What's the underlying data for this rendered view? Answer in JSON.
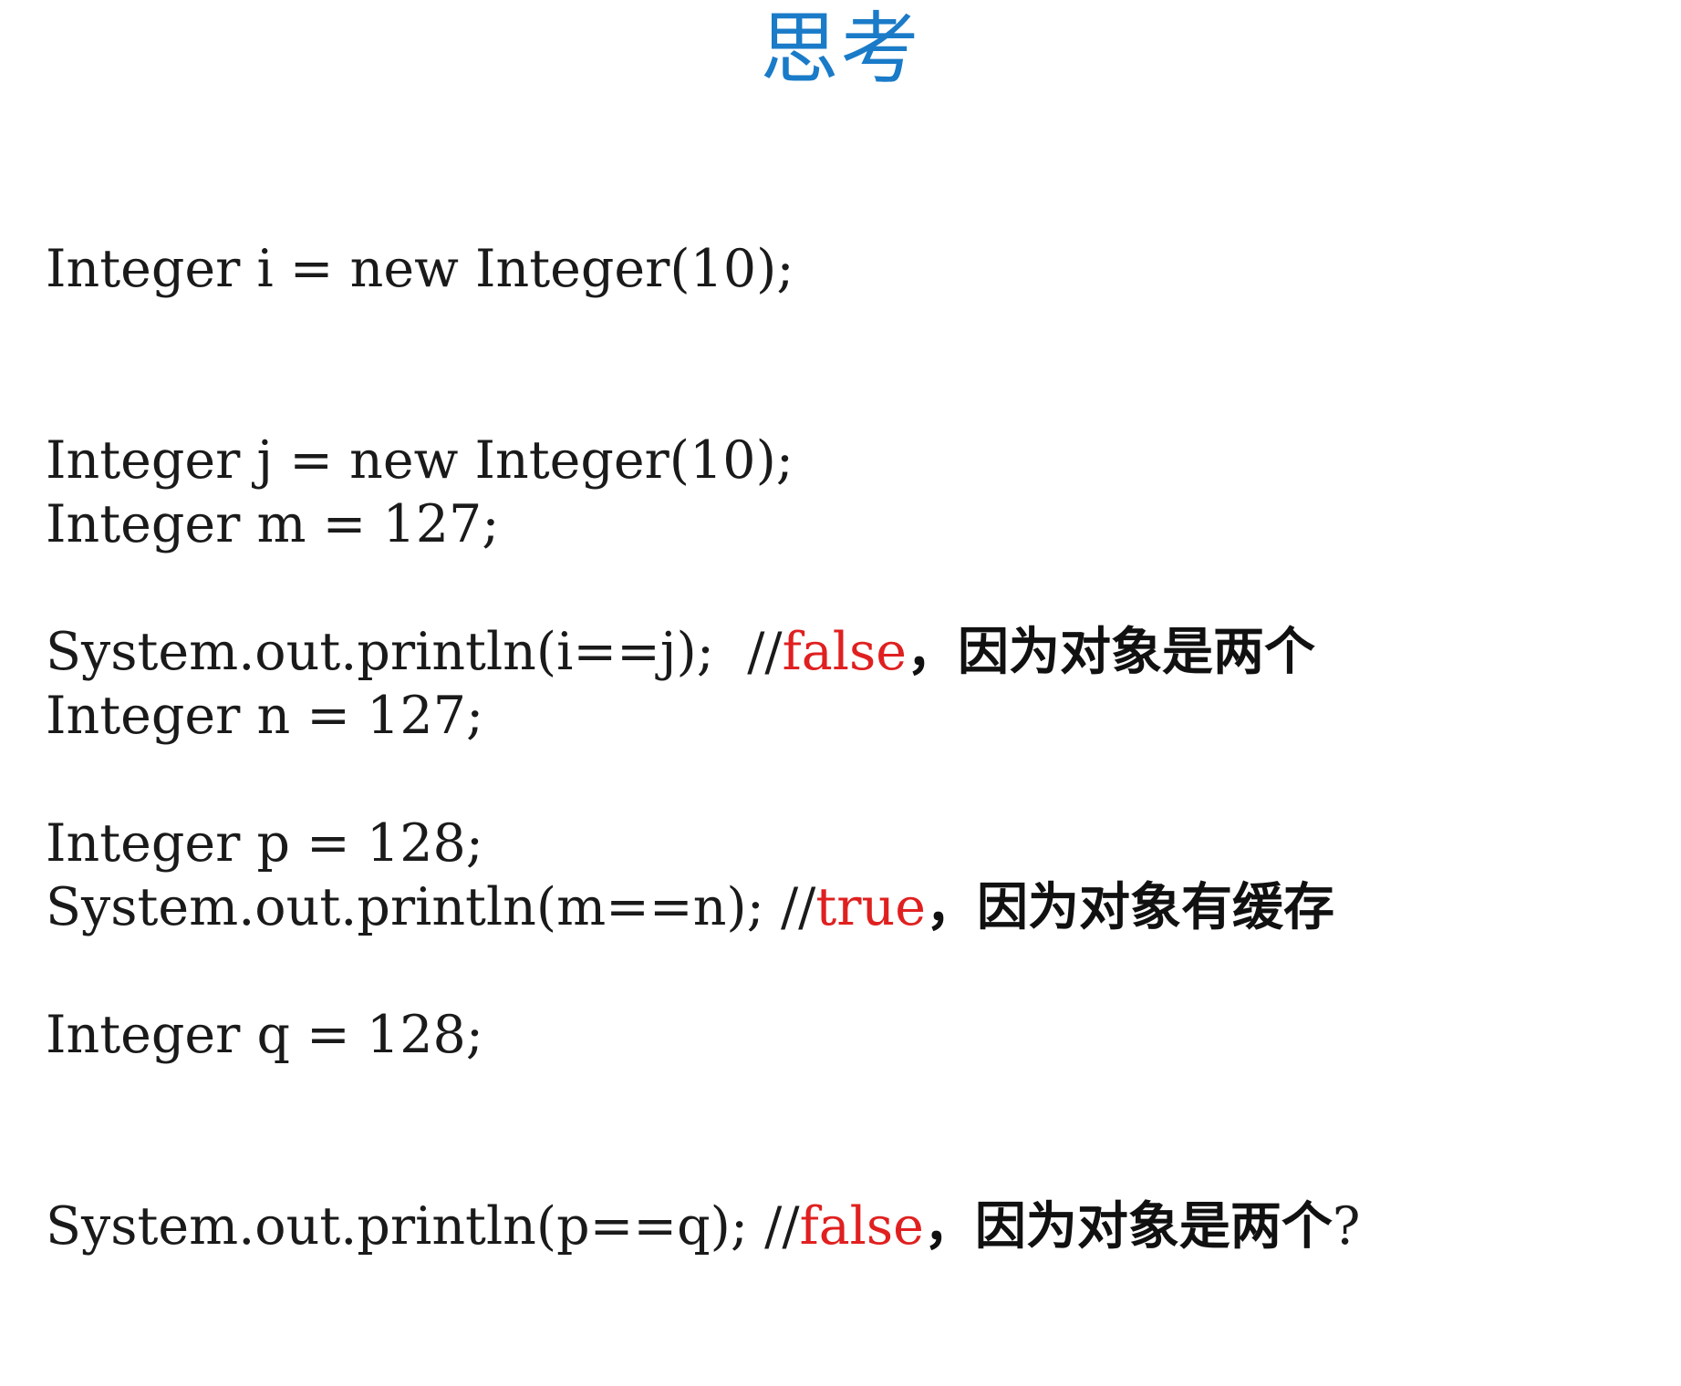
{
  "title": "思考",
  "blocks": [
    {
      "lines": [
        {
          "code": "Integer i = new Integer(10);"
        },
        {
          "code": "Integer j = new Integer(10);"
        },
        {
          "code": "System.out.println(i==j);  //",
          "keyword": "false",
          "note": "，因为对象是两个",
          "suffix": ""
        }
      ]
    },
    {
      "lines": [
        {
          "code": "Integer m = 127;"
        },
        {
          "code": "Integer n = 127;"
        },
        {
          "code": "System.out.println(m==n); //",
          "keyword": "true",
          "note": "，因为对象有缓存",
          "suffix": ""
        }
      ]
    },
    {
      "lines": [
        {
          "code": "Integer p = 128;"
        },
        {
          "code": "Integer q = 128;"
        },
        {
          "code": "System.out.println(p==q); //",
          "keyword": "false",
          "note": "，因为对象是两个",
          "suffix": "?"
        }
      ]
    }
  ],
  "colors": {
    "title": "#1a7bc8",
    "keyword": "#e02020",
    "text": "#1a1a1a"
  }
}
